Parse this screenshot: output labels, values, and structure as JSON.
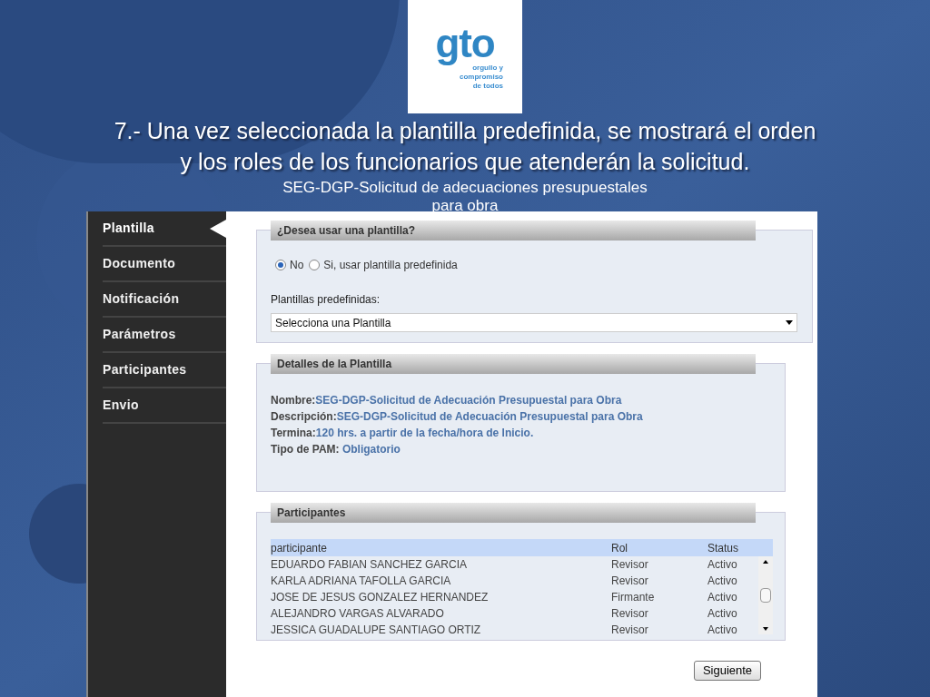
{
  "logo": {
    "word": "gto",
    "tagline": [
      "orgullo y",
      "compromiso",
      "de todos"
    ]
  },
  "title": "7.- Una vez seleccionada la plantilla predefinida, se mostrará el orden y los roles de los funcionarios que atenderán la solicitud.",
  "subtitle": [
    "SEG-DGP-Solicitud de adecuaciones presupuestales",
    "para obra"
  ],
  "sidebar": {
    "items": [
      {
        "label": "Plantilla",
        "selected": true
      },
      {
        "label": "Documento",
        "selected": false
      },
      {
        "label": "Notificación",
        "selected": false
      },
      {
        "label": "Parámetros",
        "selected": false
      },
      {
        "label": "Participantes",
        "selected": false
      },
      {
        "label": "Envio",
        "selected": false
      }
    ]
  },
  "template_question": {
    "heading": "¿Desea usar una plantilla?",
    "options": [
      {
        "label": "No",
        "selected": true
      },
      {
        "label": "Si, usar plantilla predefinida",
        "selected": false
      }
    ],
    "select_label": "Plantillas predefinidas:",
    "select_value": "Selecciona una Plantilla"
  },
  "details": {
    "heading": "Detalles de la Plantilla",
    "fields": [
      {
        "label": "Nombre:",
        "value": "SEG-DGP-Solicitud de Adecuación Presupuestal para Obra"
      },
      {
        "label": "Descripción:",
        "value": "SEG-DGP-Solicitud de Adecuación Presupuestal para Obra"
      },
      {
        "label": "Termina:",
        "value": "120 hrs. a partir de la fecha/hora de Inicio."
      },
      {
        "label": "Tipo de PAM: ",
        "value": "Obligatorio"
      }
    ]
  },
  "participants": {
    "heading": "Participantes",
    "columns": [
      "participante",
      "Rol",
      "Status"
    ],
    "rows": [
      [
        "EDUARDO FABIAN SANCHEZ GARCIA",
        "Revisor",
        "Activo"
      ],
      [
        "KARLA ADRIANA TAFOLLA GARCIA",
        "Revisor",
        "Activo"
      ],
      [
        "JOSE DE JESUS GONZALEZ HERNANDEZ",
        "Firmante",
        "Activo"
      ],
      [
        "ALEJANDRO VARGAS ALVARADO",
        "Revisor",
        "Activo"
      ],
      [
        "JESSICA GUADALUPE SANTIAGO ORTIZ",
        "Revisor",
        "Activo"
      ]
    ]
  },
  "next_button": "Siguiente"
}
